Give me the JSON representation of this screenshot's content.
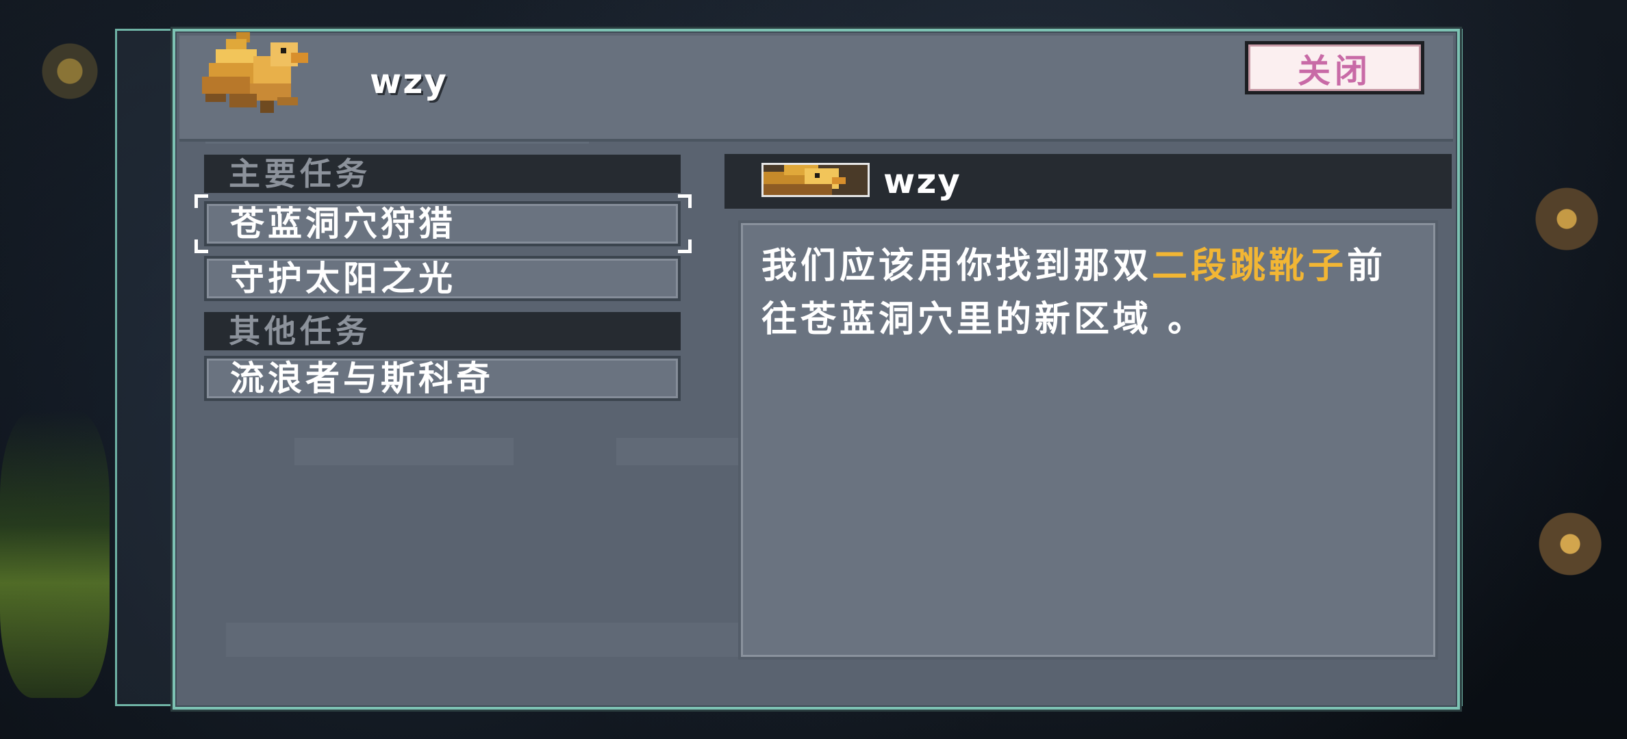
{
  "player": {
    "name": "wzy"
  },
  "header": {
    "close_label": "关闭"
  },
  "quest_list": {
    "main_section_label": "主要任务",
    "main_quests": [
      "苍蓝洞穴狩猎",
      "守护太阳之光"
    ],
    "other_section_label": "其他任务",
    "other_quests": [
      "流浪者与斯科奇"
    ],
    "selected_index": 0
  },
  "detail": {
    "name": "wzy",
    "text_before": "我们应该用你找到那双",
    "text_highlight": "二段跳靴子",
    "text_after": "前往苍蓝洞穴里的新区域 。",
    "highlight_color": "#f2b634"
  },
  "icons": [
    "griffin-avatar-icon",
    "griffin-portrait-icon"
  ],
  "colors": {
    "frame_accent": "#7dc2b3",
    "close_text": "#c86aa6",
    "panel": "#5a6370"
  }
}
